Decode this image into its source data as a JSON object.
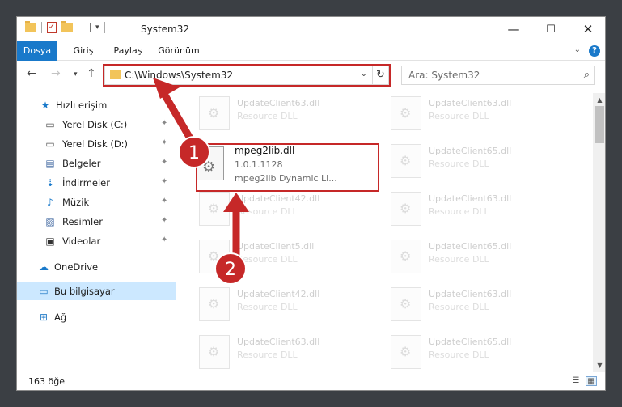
{
  "window": {
    "title": "System32",
    "controls": {
      "minimize": "—",
      "maximize": "☐",
      "close": "✕"
    }
  },
  "ribbon": {
    "tabs": [
      "Dosya",
      "Giriş",
      "Paylaş",
      "Görünüm"
    ],
    "help": "?"
  },
  "address": {
    "path": "C:\\Windows\\System32"
  },
  "search": {
    "placeholder": "Ara: System32"
  },
  "sidebar": {
    "items": [
      {
        "label": "Hızlı erişim",
        "icon": "star-icon"
      },
      {
        "label": "Yerel Disk (C:)",
        "icon": "drive-icon"
      },
      {
        "label": "Yerel Disk (D:)",
        "icon": "drive-icon"
      },
      {
        "label": "Belgeler",
        "icon": "documents-icon"
      },
      {
        "label": "İndirmeler",
        "icon": "download-icon"
      },
      {
        "label": "Müzik",
        "icon": "music-icon"
      },
      {
        "label": "Resimler",
        "icon": "pictures-icon"
      },
      {
        "label": "Videolar",
        "icon": "video-icon"
      },
      {
        "label": "OneDrive",
        "icon": "cloud-icon"
      },
      {
        "label": "Bu bilgisayar",
        "icon": "computer-icon"
      },
      {
        "label": "Ağ",
        "icon": "network-icon"
      }
    ]
  },
  "files": {
    "selected": {
      "name": "mpeg2lib.dll",
      "version": "1.0.1.1128",
      "description": "mpeg2lib Dynamic Li..."
    },
    "background": [
      {
        "name": "UpdateClient63.dll",
        "type": "Resource DLL"
      },
      {
        "name": "UpdateClient63.dll",
        "type": "Resource DLL"
      },
      {
        "name": "UpdateClient65.dll",
        "type": "Resource DLL"
      },
      {
        "name": "UpdateClient42.dll",
        "type": "Resource DLL"
      },
      {
        "name": "UpdateClient63.dll",
        "type": "Resource DLL"
      },
      {
        "name": "UpdateClient5.dll",
        "type": "Resource DLL"
      },
      {
        "name": "UpdateClient65.dll",
        "type": "Resource DLL"
      },
      {
        "name": "UpdateClient42.dll",
        "type": "Resource DLL"
      },
      {
        "name": "UpdateClient63.dll",
        "type": "Resource DLL"
      },
      {
        "name": "UpdateClient63.dll",
        "type": "Resource DLL"
      },
      {
        "name": "UpdateClient65.dll",
        "type": "Resource DLL"
      }
    ]
  },
  "status": {
    "count": "163 öğe"
  },
  "annotations": {
    "step1": "1",
    "step2": "2",
    "color": "#c62828"
  }
}
